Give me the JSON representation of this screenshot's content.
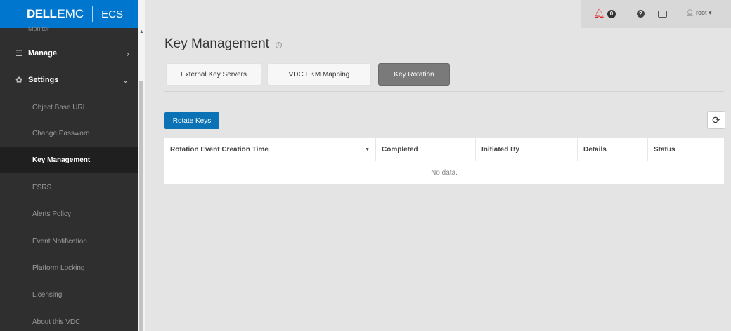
{
  "brand": {
    "dell": "DELL",
    "emc": "EMC",
    "product": "ECS"
  },
  "sidebar": {
    "partial_item": "Monitor",
    "manage": {
      "label": "Manage",
      "icon": "list-icon"
    },
    "settings": {
      "label": "Settings",
      "icon": "gear-icon"
    },
    "sub_items": [
      {
        "label": "Object Base URL"
      },
      {
        "label": "Change Password"
      },
      {
        "label": "Key Management"
      },
      {
        "label": "ESRS"
      },
      {
        "label": "Alerts Policy"
      },
      {
        "label": "Event Notification"
      },
      {
        "label": "Platform Locking"
      },
      {
        "label": "Licensing"
      },
      {
        "label": "About this VDC"
      }
    ],
    "active_item": "Key Management"
  },
  "topbar": {
    "alert_count": "0",
    "help_glyph": "?",
    "user": "root"
  },
  "page": {
    "title": "Key Management",
    "tabs": [
      {
        "label": "External Key Servers"
      },
      {
        "label": "VDC EKM Mapping"
      },
      {
        "label": "Key Rotation"
      }
    ],
    "active_tab": "Key Rotation",
    "rotate_button": "Rotate Keys"
  },
  "table": {
    "columns": [
      "Rotation Event Creation Time",
      "Completed",
      "Initiated By",
      "Details",
      "Status"
    ],
    "empty_text": "No data."
  },
  "colors": {
    "brand_blue": "#0076ce",
    "primary_button": "#0b72b5",
    "active_tab": "#7a7a7a",
    "alert_red": "#e02020",
    "sidebar_bg": "#2f2f2f"
  }
}
